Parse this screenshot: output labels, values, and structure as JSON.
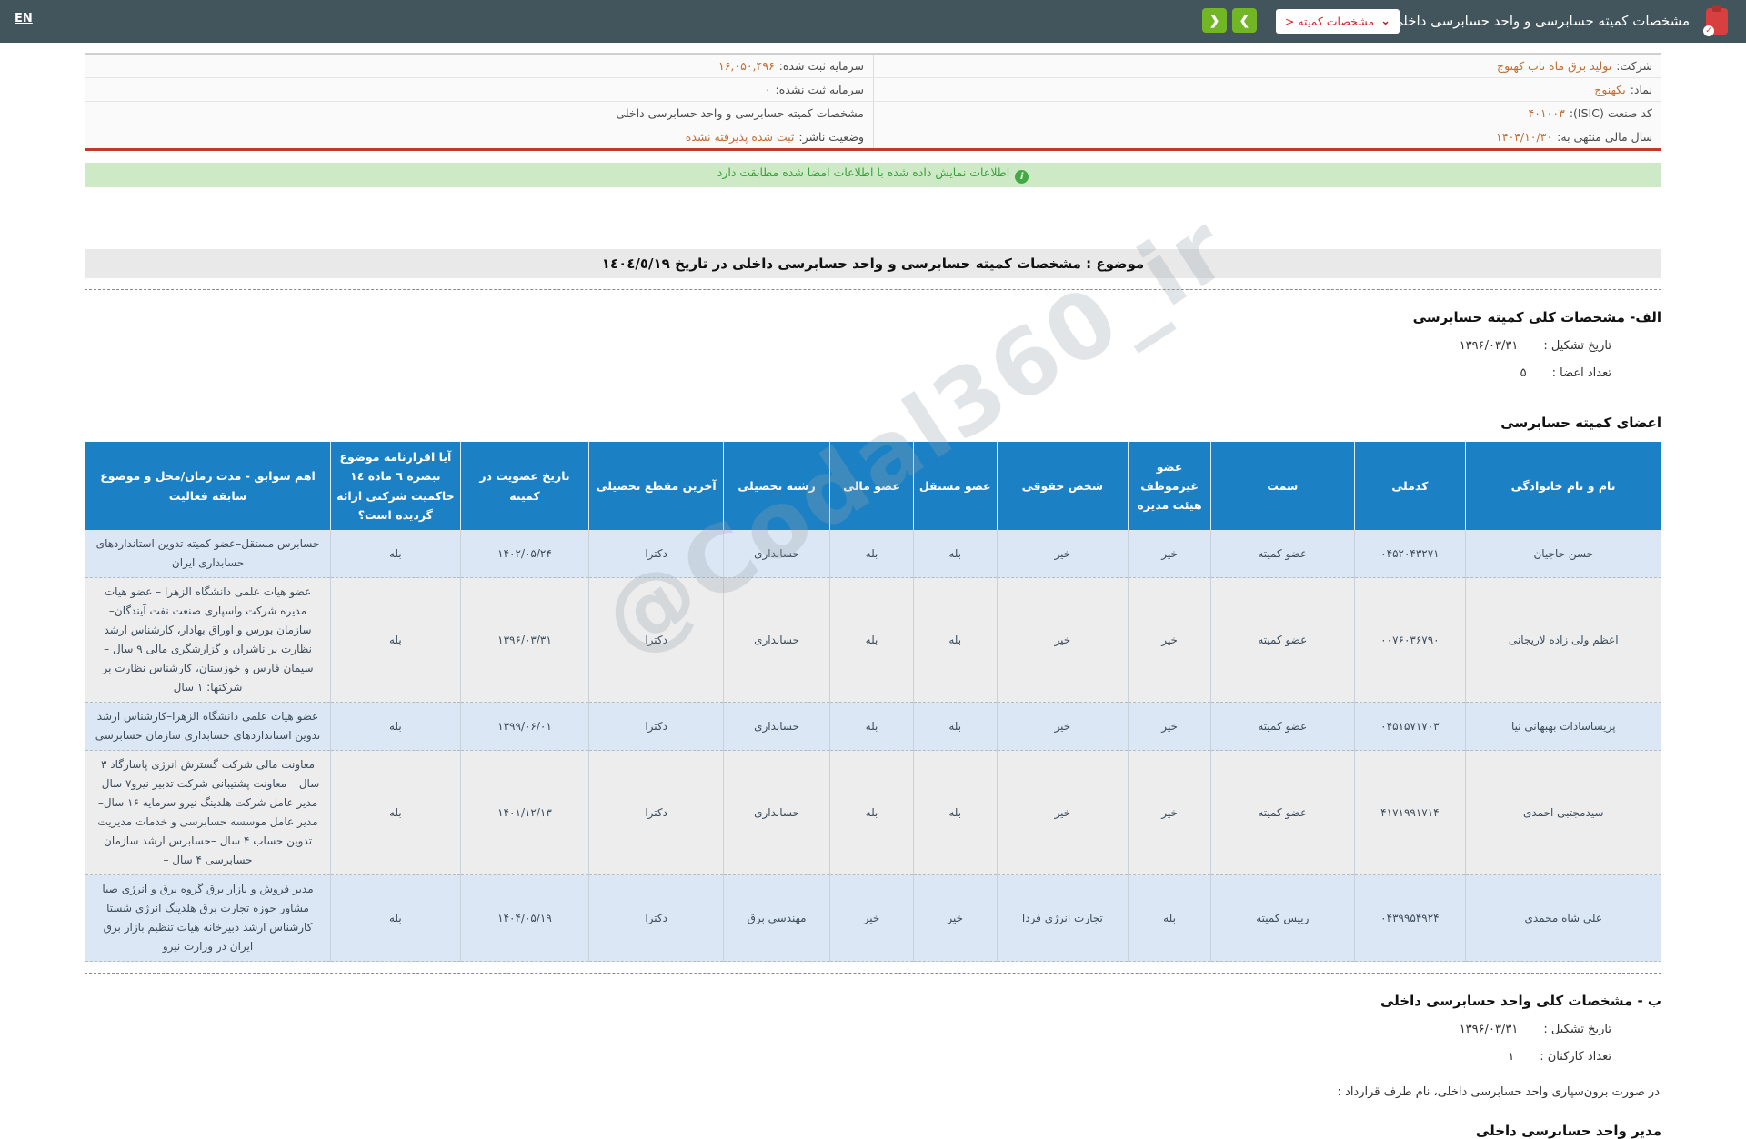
{
  "topbar": {
    "en_label": "EN",
    "title": "مشخصات کمیته حسابرسی و واحد حسابرسی داخلی",
    "dropdown_label": "مشخصات کمیته <",
    "dropdown_caret": "⌄",
    "prev_label": "❮",
    "next_label": "❯"
  },
  "info": {
    "rows": [
      {
        "right_label": "شرکت:",
        "right_value": "تولید برق ماه تاب کهنوج",
        "left_label": "سرمایه ثبت شده:",
        "left_value": "۱۶,۰۵۰,۴۹۶"
      },
      {
        "right_label": "نماد:",
        "right_value": "بکهنوج",
        "left_label": "سرمایه ثبت نشده:",
        "left_value": "۰"
      },
      {
        "right_label": "کد صنعت (ISIC):",
        "right_value": "۴۰۱۰۰۳",
        "left_label": "مشخصات کمیته حسابرسی و واحد حسابرسی داخلی",
        "left_value": ""
      },
      {
        "right_label": "سال مالی منتهی به:",
        "right_value": "۱۴۰۴/۱۰/۳۰",
        "left_label": "وضعیت ناشر:",
        "left_value": "ثبت شده پذیرفته نشده"
      }
    ]
  },
  "notice": {
    "text": "اطلاعات نمایش داده شده با اطلاعات امضا شده مطابقت دارد",
    "icon_glyph": "i"
  },
  "subject": {
    "text": "موضوع : مشخصات کمیته حسابرسی و واحد حسابرسی داخلی در تاریخ ١٤٠٤/٥/١٩"
  },
  "section_a": {
    "title": "الف- مشخصات کلی کمیته حسابرسی",
    "fields": [
      {
        "label": "تاریخ تشکیل :",
        "value": "۱۳۹۶/۰۳/۳۱"
      },
      {
        "label": "تعداد اعضا :",
        "value": "۵"
      }
    ]
  },
  "members": {
    "title": "اعضای کمیته حسابرسی",
    "headers": [
      "نام و نام خانوادگی",
      "کدملی",
      "سمت",
      "عضو غیرموظف هیئت مدیره",
      "شخص حقوقی",
      "عضو مستقل",
      "عضو مالی",
      "رشته تحصیلی",
      "آخرین مقطع تحصیلی",
      "تاریخ عضویت در کمیته",
      "آیا اقرارنامه موضوع تبصره ٦ ماده ١٤ حاکمیت شرکتی ارائه گردیده است؟",
      "اهم سوابق  - مدت زمان/محل و موضوع سابقه فعالیت"
    ],
    "rows": [
      [
        "حسن حاجیان",
        "۰۴۵۲۰۴۳۲۷۱",
        "عضو کمیته",
        "خیر",
        "خیر",
        "بله",
        "بله",
        "حسابداری",
        "دکترا",
        "۱۴۰۲/۰۵/۲۴",
        "بله",
        "حسابرس مستقل–عضو کمیته تدوین استانداردهای حسابداری ایران"
      ],
      [
        "اعظم ولی زاده لاریجانی",
        "۰۰۷۶۰۳۶۷۹۰",
        "عضو کمیته",
        "خیر",
        "خیر",
        "بله",
        "بله",
        "حسابداری",
        "دکترا",
        "۱۳۹۶/۰۳/۳۱",
        "بله",
        "عضو هیات علمی دانشگاه الزهرا – عضو هیات مدیره شرکت واسپاری صنعت نفت آیندگان– سازمان بورس و اوراق بهادار، کارشناس ارشد نظارت بر ناشران و گزارشگری مالی ۹ سال – سیمان فارس و خوزستان، کارشناس نظارت بر شرکتها: ۱ سال"
      ],
      [
        "پریساسادات بهبهانی نیا",
        "۰۴۵۱۵۷۱۷۰۳",
        "عضو کمیته",
        "خیر",
        "خیر",
        "بله",
        "بله",
        "حسابداری",
        "دکترا",
        "۱۳۹۹/۰۶/۰۱",
        "بله",
        "عضو هیات علمی دانشگاه الزهرا–کارشناس ارشد تدوین استانداردهای حسابداری سازمان حسابرسی"
      ],
      [
        "سیدمجتبی احمدی",
        "۴۱۷۱۹۹۱۷۱۴",
        "عضو کمیته",
        "خیر",
        "خیر",
        "بله",
        "بله",
        "حسابداری",
        "دکترا",
        "۱۴۰۱/۱۲/۱۳",
        "بله",
        "معاونت مالی شرکت گسترش انرژی پاسارگاد ۳ سال – معاونت پشتیبانی شرکت تدبیر نیرو۷ سال– مدیر عامل شرکت هلدینگ نیرو سرمایه ۱۶ سال– مدیر عامل موسسه حسابرسی و خدمات مدیریت تدوین حساب ۴ سال –حسابرس ارشد سازمان حسابرسی ۴ سال –"
      ],
      [
        "علی شاه محمدی",
        "۰۴۳۹۹۵۴۹۲۴",
        "رییس کمیته",
        "بله",
        "تجارت انرژی فردا",
        "خیر",
        "خیر",
        "مهندسی برق",
        "دکترا",
        "۱۴۰۴/۰۵/۱۹",
        "بله",
        "مدیر فروش و بازار برق گروه برق و انرژی صبا مشاور حوزه تجارت برق هلدینگ انرژی شستا کارشناس ارشد دبیرخانه هیات تنظیم بازار برق ایران در وزارت نیرو"
      ]
    ]
  },
  "section_b": {
    "title": "ب - مشخصات کلی واحد حسابرسی داخلی",
    "fields": [
      {
        "label": "تاریخ تشکیل :",
        "value": "۱۳۹۶/۰۳/۳۱"
      },
      {
        "label": "تعداد کارکنان :",
        "value": "۱"
      }
    ],
    "outsource_label": "در صورت برون‌سپاری واحد حسابرسی داخلی، نام طرف قرارداد :"
  },
  "footer_heading": "مدیر واحد حسابرسی داخلی",
  "watermark": "@Codal360_ir",
  "colors": {
    "topbar_bg": "#42545c",
    "accent_green": "#72b626",
    "accent_red": "#d02a2a",
    "value_orange": "#bf6e35",
    "table_header_blue": "#1b80c4",
    "row_blue": "#dbe7f5",
    "row_gray": "#ededed",
    "notice_bg": "#cde9c6",
    "notice_text": "#3aa13a"
  }
}
